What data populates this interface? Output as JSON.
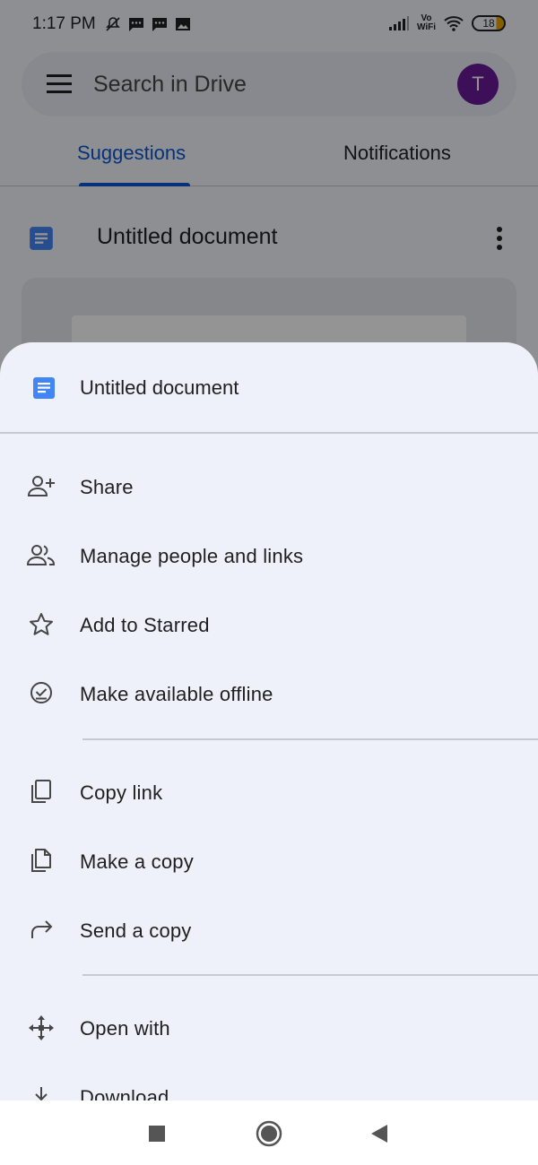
{
  "status_bar": {
    "time": "1:17 PM",
    "battery": "18",
    "vowifi_top": "Vo",
    "vowifi_bottom": "WiFi",
    "icons": [
      "mute-icon",
      "message-icon",
      "message-icon",
      "gallery-icon",
      "signal-icon",
      "vowifi-icon",
      "wifi-icon",
      "battery-icon"
    ]
  },
  "search": {
    "placeholder": "Search in Drive",
    "avatar_letter": "T",
    "avatar_color": "#6a1b9a"
  },
  "tabs": [
    {
      "label": "Suggestions",
      "active": true
    },
    {
      "label": "Notifications",
      "active": false
    }
  ],
  "background_file": {
    "title": "Untitled document"
  },
  "sheet": {
    "title": "Untitled document",
    "groups": [
      [
        {
          "label": "Share",
          "icon": "person-add-icon"
        },
        {
          "label": "Manage people and links",
          "icon": "people-icon"
        },
        {
          "label": "Add to Starred",
          "icon": "star-icon"
        },
        {
          "label": "Make available offline",
          "icon": "offline-check-icon"
        }
      ],
      [
        {
          "label": "Copy link",
          "icon": "copy-link-icon"
        },
        {
          "label": "Make a copy",
          "icon": "file-copy-icon"
        },
        {
          "label": "Send a copy",
          "icon": "forward-arrow-icon"
        }
      ],
      [
        {
          "label": "Open with",
          "icon": "move-arrows-icon"
        },
        {
          "label": "Download",
          "icon": "download-icon"
        }
      ]
    ]
  },
  "colors": {
    "accent": "#0b57d0",
    "doc_blue": "#4285f4",
    "sheet_bg": "#eef1f9"
  },
  "nav_buttons": [
    "recents-square-icon",
    "home-circle-icon",
    "back-triangle-icon"
  ]
}
